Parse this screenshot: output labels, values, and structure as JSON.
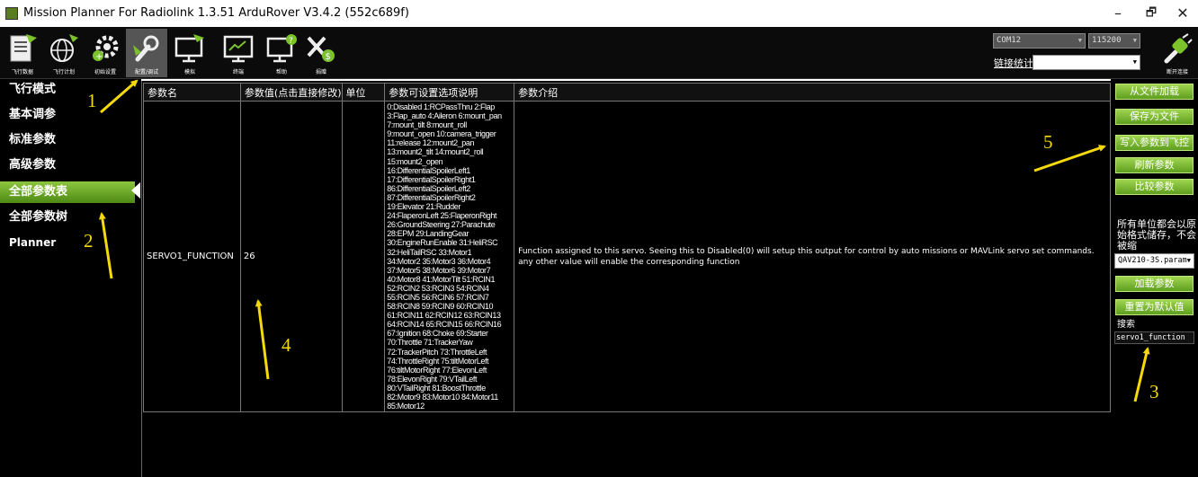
{
  "window": {
    "title": "Mission Planner For Radiolink 1.3.51 ArduRover V3.4.2 (552c689f)",
    "controls": {
      "minimize": "–",
      "maximize": "🗗",
      "close": "✕"
    }
  },
  "toolbar": {
    "buttons": [
      {
        "label": "飞行数据",
        "icon": "flight-data-icon"
      },
      {
        "label": "飞行计划",
        "icon": "globe-icon"
      },
      {
        "label": "初始设置",
        "icon": "gear-icon"
      },
      {
        "label": "配置/调试",
        "icon": "wrench-icon"
      },
      {
        "label": "模拟",
        "icon": "monitor-icon"
      },
      {
        "label": "终端",
        "icon": "terminal-icon"
      },
      {
        "label": "帮助",
        "icon": "help-icon"
      },
      {
        "label": "捐赠",
        "icon": "donate-icon"
      }
    ],
    "port": "COM12",
    "baud": "115200",
    "link_stats": "链接统计",
    "connect_label": "断开连接"
  },
  "left_nav": {
    "items": [
      "飞行模式",
      "基本调参",
      "标准参数",
      "高级参数",
      "全部参数表",
      "全部参数树",
      "Planner"
    ],
    "active_index": 4
  },
  "table": {
    "headers": [
      "参数名",
      "参数值(点击直接修改)",
      "单位",
      "参数可设置选项说明",
      "参数介绍"
    ],
    "row": {
      "name": "SERVO1_FUNCTION",
      "value": "26",
      "unit": "",
      "options": [
        "0:Disabled 1:RCPassThru 2:Flap",
        "3:Flap_auto 4:Aileron 6:mount_pan",
        "7:mount_tilt 8:mount_roll",
        "9:mount_open 10:camera_trigger",
        "11:release 12:mount2_pan",
        "13:mount2_tilt 14:mount2_roll",
        "15:mount2_open",
        "16:DifferentialSpoilerLeft1",
        "17:DifferentialSpoilerRight1",
        "86:DifferentialSpoilerLeft2",
        "87:DifferentialSpoilerRight2",
        "19:Elevator 21:Rudder",
        "24:FlaperonLeft 25:FlaperonRight",
        "26:GroundSteering 27:Parachute",
        "28:EPM 29:LandingGear",
        "30:EngineRunEnable 31:HeliRSC",
        "32:HeliTailRSC 33:Motor1",
        "34:Motor2 35:Motor3 36:Motor4",
        "37:Motor5 38:Motor6 39:Motor7",
        "40:Motor8 41:MotorTilt 51:RCIN1",
        "52:RCIN2 53:RCIN3 54:RCIN4",
        "55:RCIN5 56:RCIN6 57:RCIN7",
        "58:RCIN8 59:RCIN9 60:RCIN10",
        "61:RCIN11 62:RCIN12 63:RCIN13",
        "64:RCIN14 65:RCIN15 66:RCIN16",
        "67:Ignition 68:Choke 69:Starter",
        "70:Throttle 71:TrackerYaw",
        "72:TrackerPitch 73:ThrottleLeft",
        "74:ThrottleRight 75:tiltMotorLeft",
        "76:tiltMotorRight 77:ElevonLeft",
        "78:ElevonRight 79:VTailLeft",
        "80:VTailRight 81:BoostThrottle",
        "82:Motor9 83:Motor10 84:Motor11",
        "85:Motor12"
      ],
      "description": "Function assigned to this servo. Seeing this to Disabled(0) will setup this output for control by auto missions or MAVLink servo set commands. any other value will enable the corresponding function"
    }
  },
  "right_panel": {
    "buttons": [
      "从文件加载",
      "保存为文件",
      "写入参数到飞控",
      "刷新参数",
      "比较参数"
    ],
    "note": "所有单位都会以原始格式储存，不会被缩",
    "preset_file": "QAV210-3S.param",
    "load_button": "加载参数",
    "reset_button": "重置为默认值",
    "search_label": "搜索",
    "search_value": "servo1_function"
  },
  "annotations": {
    "color": "#f5d90a",
    "numbers": [
      "1",
      "2",
      "3",
      "4",
      "5"
    ]
  }
}
